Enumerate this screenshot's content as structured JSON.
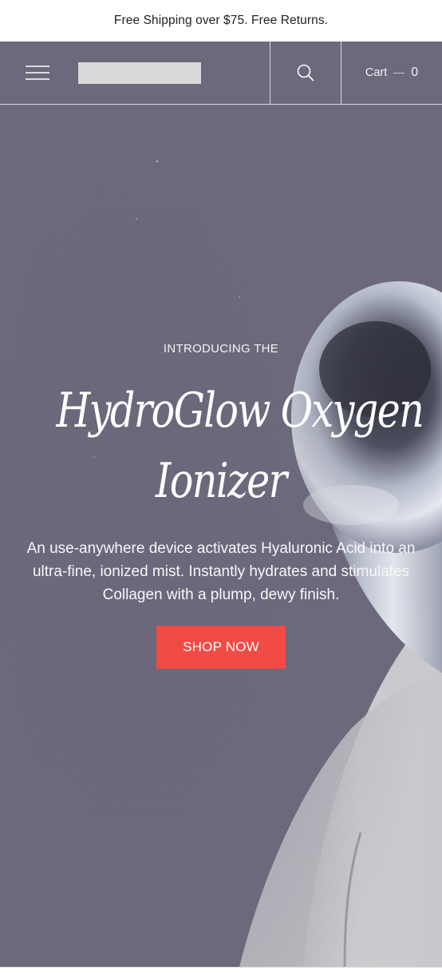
{
  "announcement": {
    "text": "Free Shipping over $75. Free Returns."
  },
  "header": {
    "menu_icon": "hamburger-menu-icon",
    "search_icon": "search-icon",
    "cart_label": "Cart",
    "cart_count": "0"
  },
  "hero": {
    "eyebrow": "INTRODUCING THE",
    "title_line1": "HydroGlow Oxygen",
    "title_line2": "Ionizer",
    "description": "An use-anywhere device activates Hyaluronic Acid into an ultra-fine, ionized mist. Instantly hydrates and stimulates Collagen with a plump, dewy finish.",
    "cta_label": "SHOP NOW"
  },
  "colors": {
    "cta": "#f24a45",
    "hero_tint": "#6c6a7b",
    "text_light": "#ffffff"
  }
}
